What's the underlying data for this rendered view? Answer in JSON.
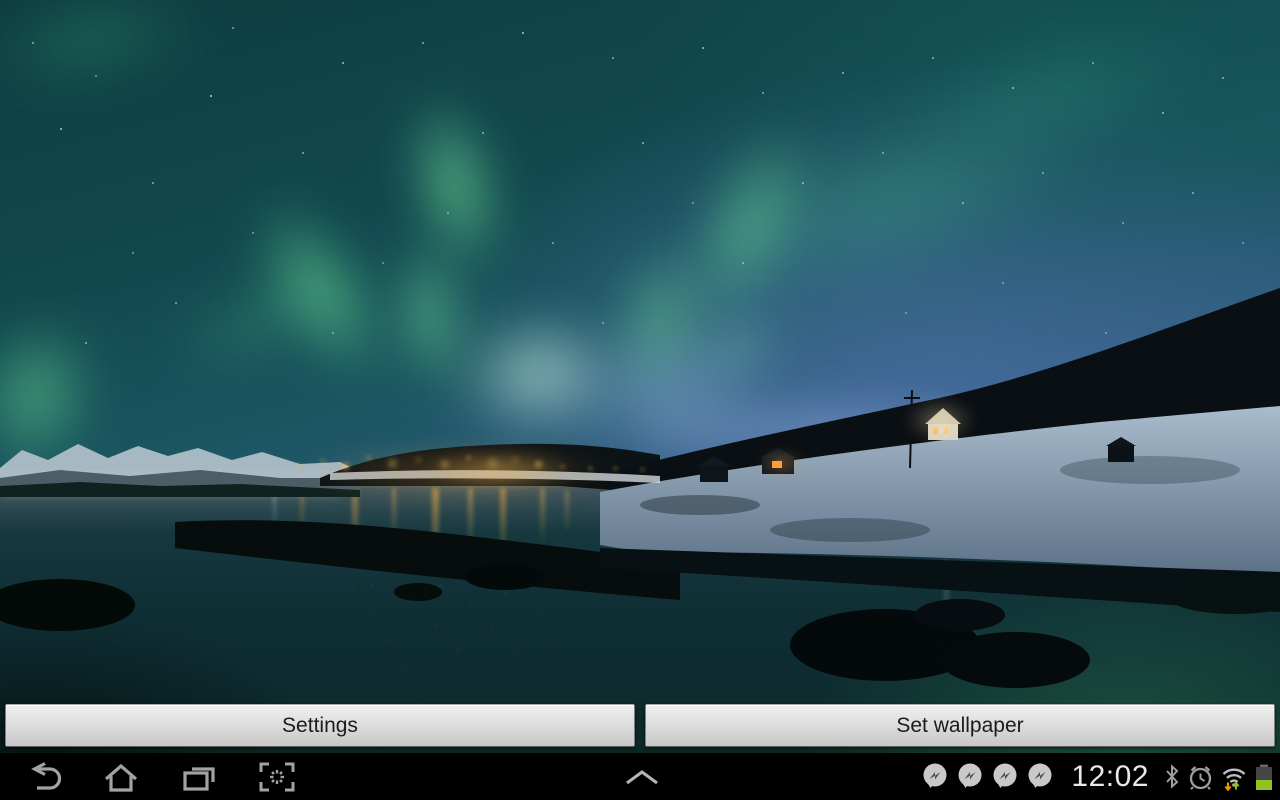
{
  "screen": {
    "type": "android tablet live-wallpaper preview"
  },
  "wallpaper": {
    "description": "Green aurora borealis ribbons swirling in a teal-to-blue starry night sky over a snowy coastal village; warm orange village lights reflect as streaks and sparkles in the dark bay water; dark forested hill with a lit white house on the right",
    "palette": {
      "sky_teal": "#11484e",
      "sky_blue": "#4a6ba4",
      "aurora_green": "#7fe8a6",
      "aurora_glow": "#d9ffef",
      "village_light": "#ffb341",
      "water_dark": "#0e2c31",
      "snow": "#a9bccd"
    }
  },
  "action_bar": {
    "settings_label": "Settings",
    "set_wallpaper_label": "Set wallpaper"
  },
  "navbar": {
    "back_icon": "back",
    "home_icon": "home",
    "recents_icon": "recent-apps",
    "capture_icon": "screen-capture",
    "tray_icon": "chevron-up",
    "status": {
      "clock": "12:02",
      "notification_icons": [
        "messenger",
        "messenger",
        "messenger",
        "messenger"
      ],
      "system_icons": [
        "bluetooth",
        "alarm",
        "wifi-traffic",
        "battery"
      ]
    }
  }
}
